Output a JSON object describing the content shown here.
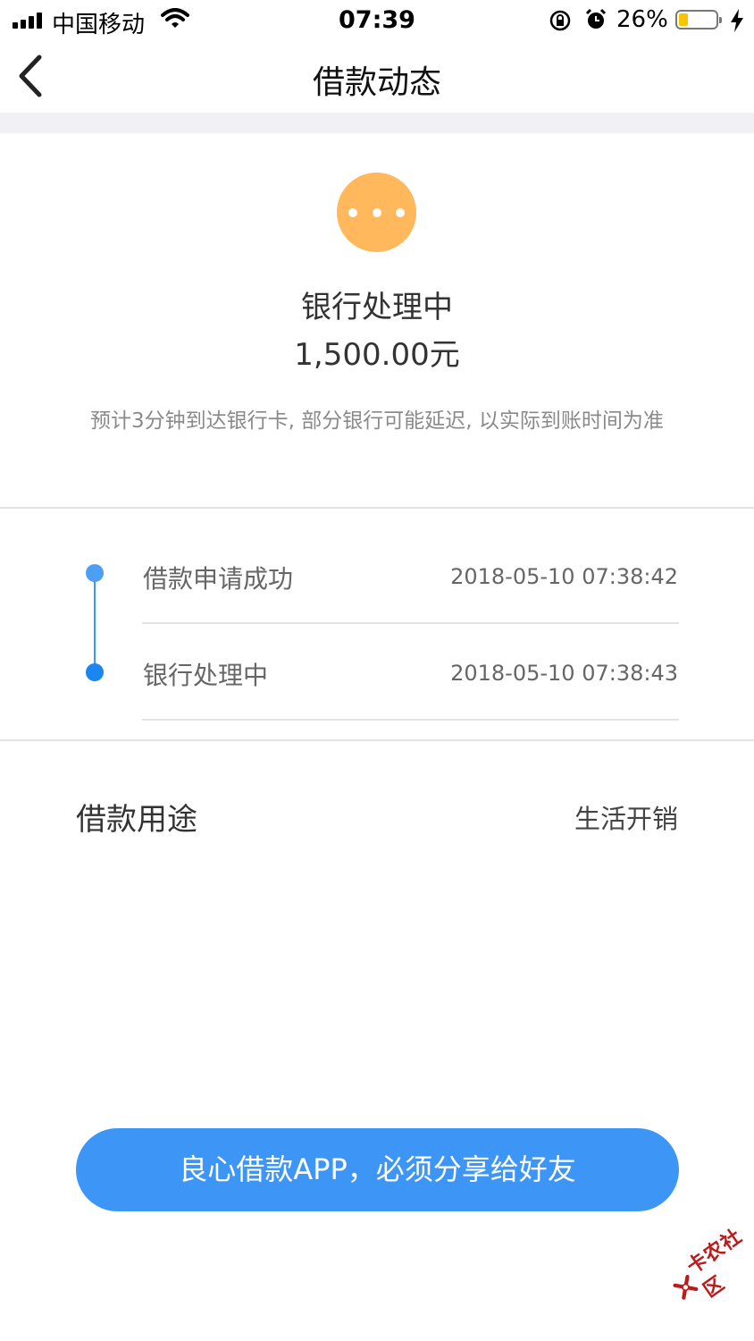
{
  "status_bar": {
    "carrier": "中国移动",
    "time": "07:39",
    "battery_percent": "26%",
    "battery_level": 0.26,
    "icons": [
      "signal-icon",
      "wifi-icon",
      "orientation-lock-icon",
      "alarm-icon",
      "battery-icon",
      "charging-bolt-icon"
    ]
  },
  "nav": {
    "back_icon": "chevron-left-icon",
    "title": "借款动态"
  },
  "status": {
    "icon": "more-dots-icon",
    "icon_color": "#ffb95c",
    "title": "银行处理中",
    "amount": "1,500.00元",
    "hint": "预计3分钟到达银行卡, 部分银行可能延迟, 以实际到账时间为准"
  },
  "timeline": {
    "line_color": "#3d95f5",
    "items": [
      {
        "label": "借款申请成功",
        "time": "2018-05-10 07:38:42",
        "dot_color": "#4d9ff5"
      },
      {
        "label": "银行处理中",
        "time": "2018-05-10 07:38:43",
        "dot_color": "#1a87f0"
      }
    ]
  },
  "purpose": {
    "label": "借款用途",
    "value": "生活开销"
  },
  "share_button": {
    "label": "良心借款APP，必须分享给好友",
    "color": "#3d96f6"
  },
  "watermark": {
    "text": "卡农社区",
    "icon": "kanong-logo-icon"
  }
}
